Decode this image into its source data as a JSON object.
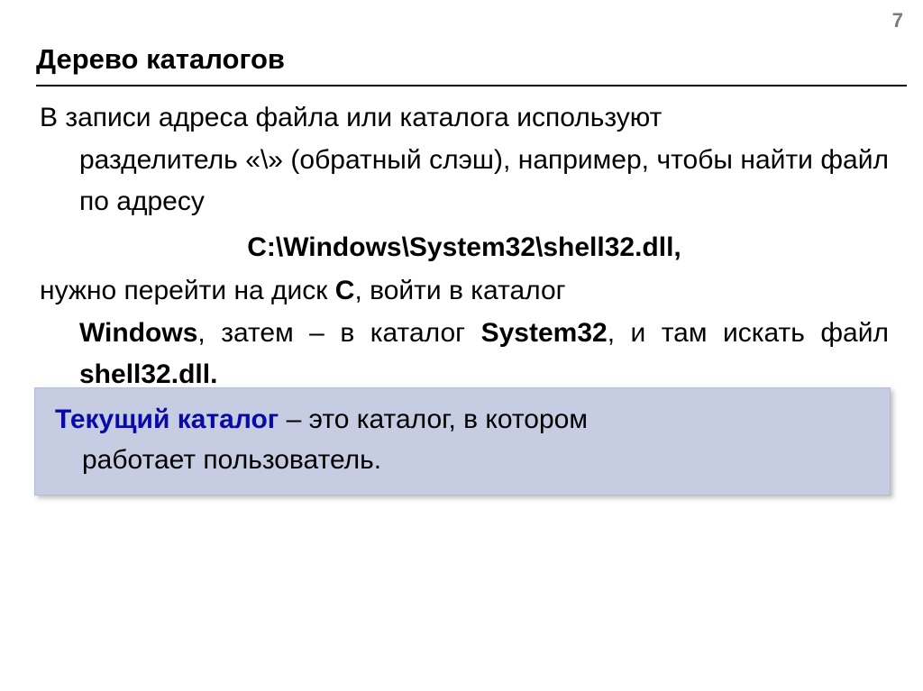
{
  "page_number": "7",
  "title": "Дерево каталогов",
  "body": {
    "p1_first": "В записи адреса файла или каталога используют",
    "p1_rest": "разделитель «\\» (обратный слэш), например, чтобы найти файл по адресу",
    "path": "C:\\Windows\\System32\\shell32.dll,",
    "p2_a": "нужно перейти на диск ",
    "p2_b_C": "C",
    "p2_c": ", войти в каталог ",
    "p2_d_Windows": "Windows",
    "p2_e": ", затем – в каталог ",
    "p2_f_System32": "System32",
    "p2_g": ", и там искать файл ",
    "p2_h_shell": "shell32.dll."
  },
  "callout": {
    "term": "Текущий каталог",
    "l1_rest": " – это каталог, в котором",
    "l2": "работает пользователь."
  }
}
